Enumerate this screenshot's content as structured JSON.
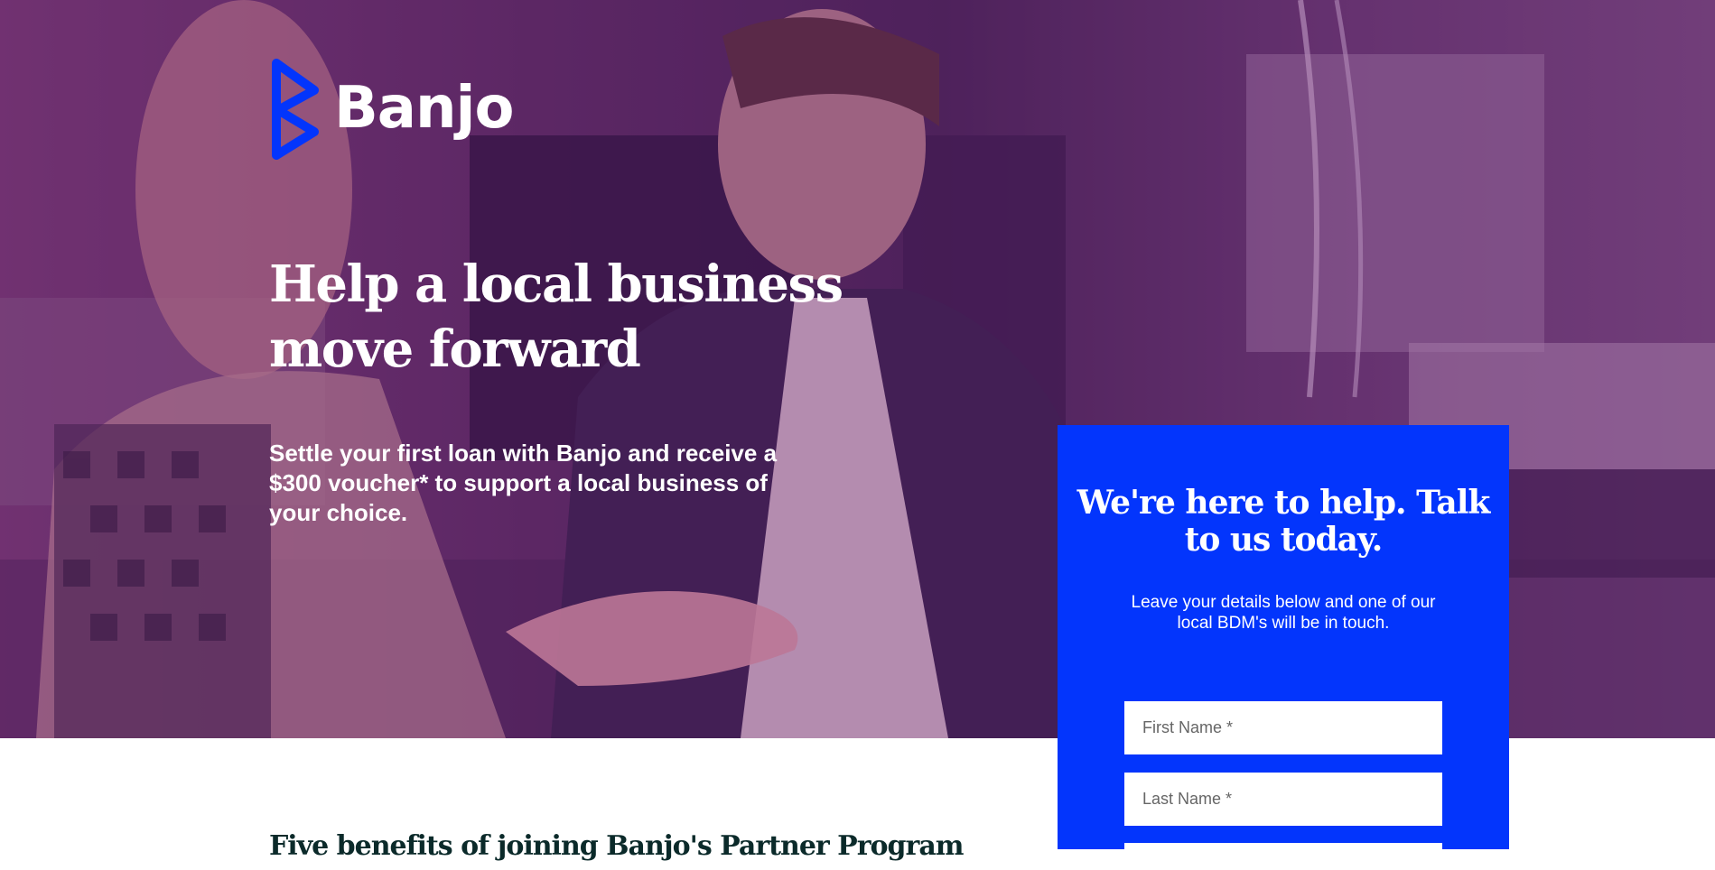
{
  "brand": {
    "name": "Banjo",
    "logo_color": "#0335fc",
    "logo_icon": "banjo-b-mark-icon"
  },
  "hero": {
    "headline": "Help a local business move forward",
    "subheadline": "Settle your first loan with Banjo and receive a $300 voucher* to support a local business of your choice.",
    "overlay_color": "#6b2d73"
  },
  "contact_form": {
    "title": "We're here to help. Talk to us today.",
    "description": "Leave your details below and one of our local BDM's will be in touch.",
    "first_name_placeholder": "First Name *",
    "last_name_placeholder": "Last Name *",
    "background_color": "#0335fc"
  },
  "benefits": {
    "title": "Five benefits of joining Banjo's Partner Program"
  }
}
